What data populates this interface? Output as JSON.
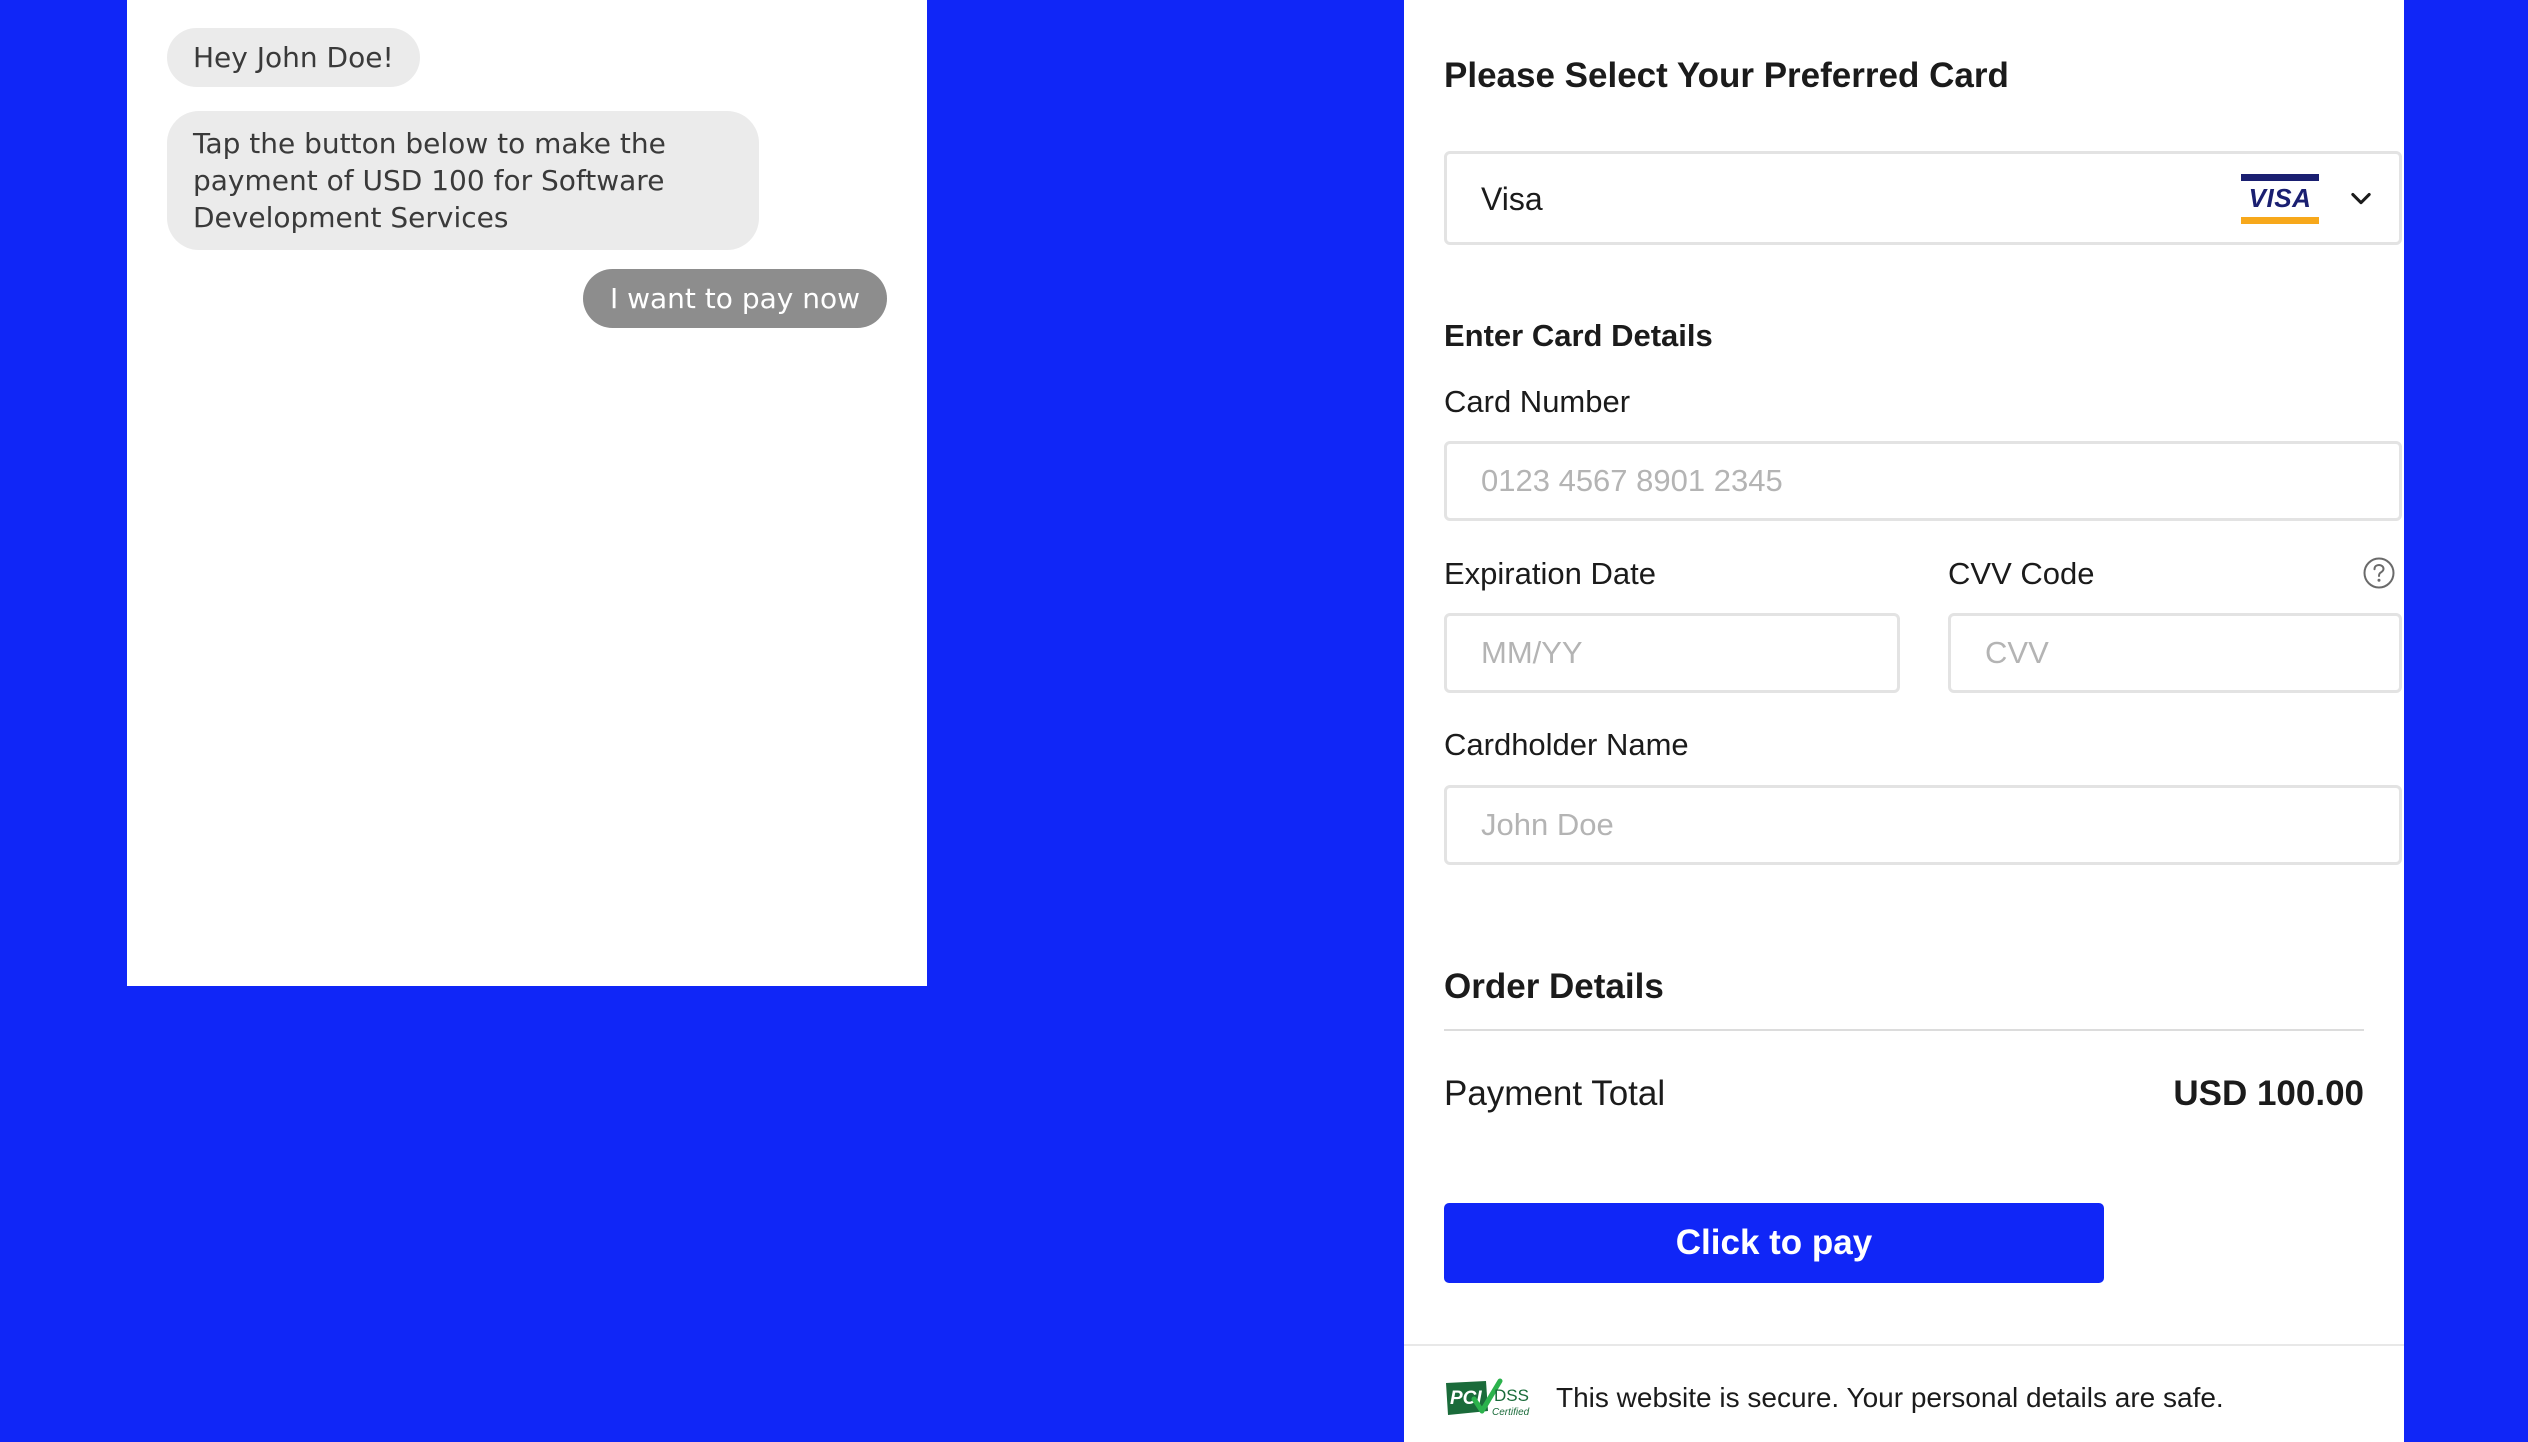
{
  "chat": {
    "messages": [
      {
        "from": "bot",
        "text": "Hey John Doe!"
      },
      {
        "from": "bot",
        "text": "Tap the button below to make the payment of USD 100 for Software Development Services"
      },
      {
        "from": "user",
        "text": "I want to pay now"
      }
    ]
  },
  "payment": {
    "select_heading": "Please Select Your Preferred Card",
    "card_select": {
      "selected": "Visa",
      "logo_text": "VISA",
      "logo_icon": "visa-logo",
      "chevron_icon": "chevron-down-icon"
    },
    "card_details_heading": "Enter Card Details",
    "card_number": {
      "label": "Card Number",
      "placeholder": "0123 4567 8901 2345",
      "value": ""
    },
    "expiration": {
      "label": "Expiration Date",
      "placeholder": "MM/YY",
      "value": ""
    },
    "cvv": {
      "label": "CVV Code",
      "placeholder": "CVV",
      "value": "",
      "help_icon": "question-circle-icon"
    },
    "cardholder": {
      "label": "Cardholder Name",
      "placeholder": "John Doe",
      "value": ""
    },
    "order_heading": "Order Details",
    "total_label": "Payment Total",
    "total_value": "USD 100.00",
    "pay_button": "Click to pay",
    "secure_note": "This website is secure. Your personal details are safe.",
    "pci_badge": {
      "icon": "pci-dss-badge",
      "text_pci": "PCI",
      "text_dss": "DSS",
      "text_cert": "Certified"
    }
  },
  "colors": {
    "background": "#1026f7",
    "accent": "#1026f7",
    "incoming_bubble": "#ebebeb",
    "outgoing_bubble": "#8d8d8d",
    "visa_blue": "#1a1f71",
    "visa_gold": "#f7a81b",
    "pci_green": "#1a8a4a"
  }
}
